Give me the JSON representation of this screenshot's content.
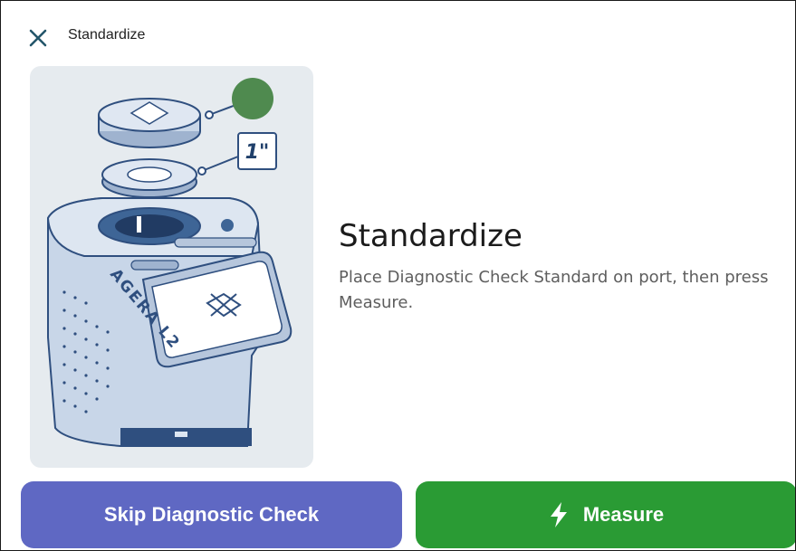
{
  "header": {
    "close_icon": "close-icon",
    "title": "Standardize"
  },
  "illustration": {
    "size_label": "1\"",
    "brand_text": "AGERA L2",
    "colors": {
      "panel_bg": "#e6ebef",
      "device_fill": "#c8d6e8",
      "device_stroke": "#2f4f7f",
      "indicator": "#4f8a4f"
    }
  },
  "main": {
    "title": "Standardize",
    "description": "Place Diagnostic Check Standard on port, then press Measure."
  },
  "actions": {
    "skip_label": "Skip Diagnostic Check",
    "measure_label": "Measure",
    "measure_icon": "lightning-bolt-icon",
    "colors": {
      "skip": "#5f68c3",
      "measure": "#2a9b34"
    }
  }
}
